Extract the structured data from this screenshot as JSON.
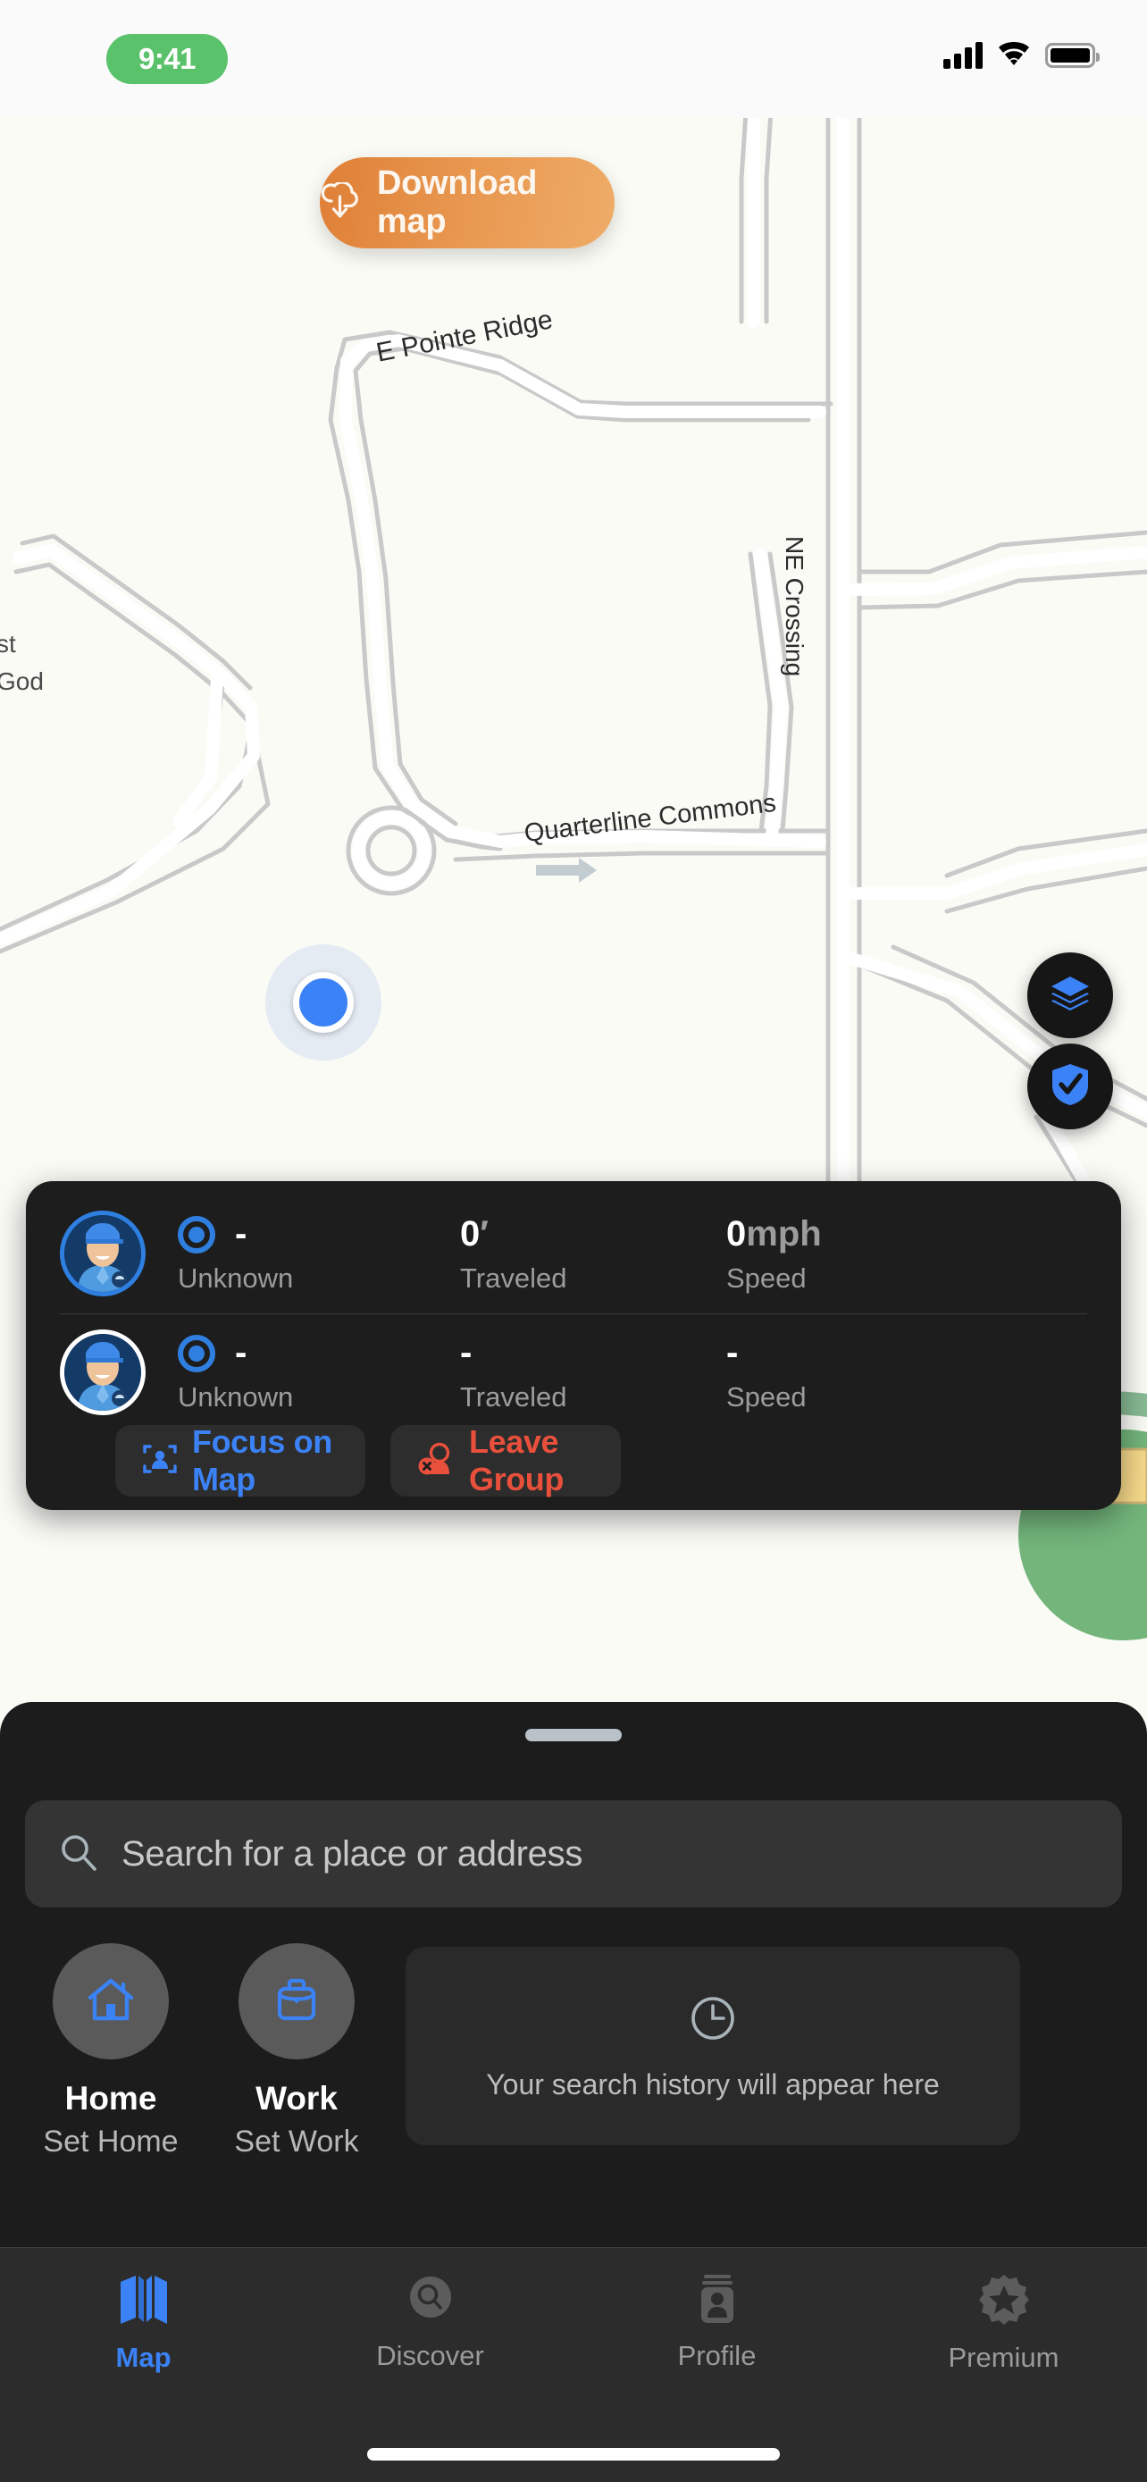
{
  "status_bar": {
    "time": "9:41",
    "time_pill_color": "#59c26a",
    "signal_icon": "cellular-signal-icon",
    "wifi_icon": "wifi-icon",
    "battery_icon": "battery-full-icon"
  },
  "map": {
    "download_button": {
      "label": "Download map",
      "icon": "cloud-download-icon",
      "gradient_start": "#df7f37",
      "gradient_end": "#eeac68"
    },
    "street_labels": [
      {
        "text": "E Pointe Ridge"
      },
      {
        "text": "NE Crossing"
      },
      {
        "text": "Quarterline Commons"
      }
    ],
    "poi_labels": [
      {
        "line1": "st",
        "line2": "God"
      }
    ],
    "controls": [
      {
        "name": "map-layers-button",
        "icon": "layers-icon"
      },
      {
        "name": "safety-shield-button",
        "icon": "shield-check-icon"
      }
    ],
    "user_marker": {
      "icon": "user-location-icon",
      "color": "#3b82f6"
    }
  },
  "group_card": {
    "members": [
      {
        "avatar": "member-avatar",
        "ring_color": "#2f7fe0",
        "status_value": "-",
        "status_label": "Unknown",
        "traveled_value": "0",
        "traveled_unit": "′",
        "traveled_label": "Traveled",
        "speed_value": "0",
        "speed_unit": "mph",
        "speed_label": "Speed"
      },
      {
        "avatar": "member-avatar",
        "ring_color": "#ffffff",
        "status_value": "-",
        "status_label": "Unknown",
        "traveled_value": "-",
        "traveled_unit": "",
        "traveled_label": "Traveled",
        "speed_value": "-",
        "speed_unit": "",
        "speed_label": "Speed"
      }
    ],
    "actions": {
      "focus": {
        "label": "Focus on Map",
        "icon": "focus-person-icon",
        "color": "#3b82f6"
      },
      "leave": {
        "label": "Leave Group",
        "icon": "person-remove-icon",
        "color": "#e8503c"
      }
    }
  },
  "sheet": {
    "search": {
      "placeholder": "Search for a place or address",
      "icon": "search-icon"
    },
    "quick_actions": [
      {
        "title": "Home",
        "subtitle": "Set Home",
        "icon": "house-icon"
      },
      {
        "title": "Work",
        "subtitle": "Set Work",
        "icon": "briefcase-icon"
      }
    ],
    "history": {
      "text": "Your search history will appear here",
      "icon": "clock-icon"
    }
  },
  "tab_bar": {
    "tabs": [
      {
        "label": "Map",
        "icon": "folded-map-icon",
        "active": true
      },
      {
        "label": "Discover",
        "icon": "discover-search-icon",
        "active": false
      },
      {
        "label": "Profile",
        "icon": "profile-person-icon",
        "active": false
      },
      {
        "label": "Premium",
        "icon": "premium-star-icon",
        "active": false
      }
    ],
    "active_color": "#3b82f6",
    "inactive_color": "#9a9a9a"
  }
}
